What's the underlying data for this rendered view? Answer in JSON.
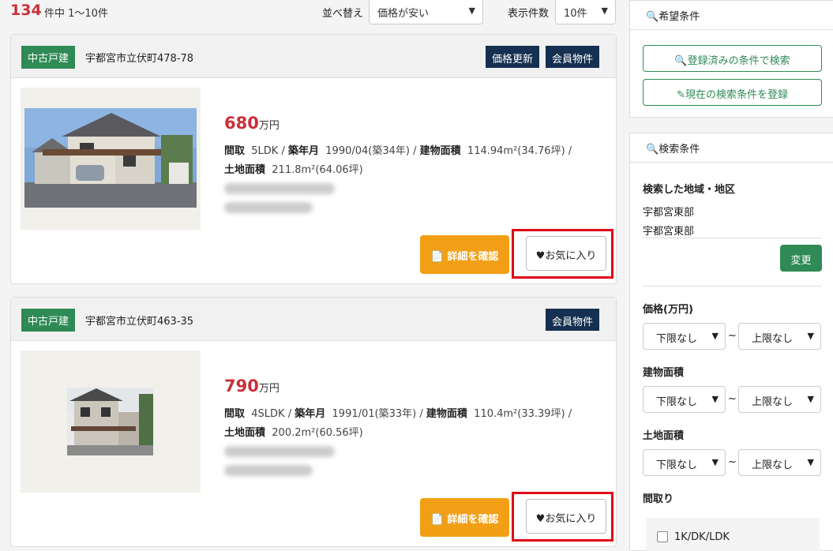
{
  "results": {
    "total": "134",
    "range_text": "件中 1〜10件",
    "sort_label": "並べ替え",
    "sort_value": "価格が安い",
    "count_label": "表示件数",
    "count_value": "10件"
  },
  "listings": [
    {
      "type": "中古戸建",
      "address": "宇都宮市立伏町478-78",
      "tags": [
        "価格更新",
        "会員物件"
      ],
      "price": "680",
      "price_unit": "万円",
      "layout_label": "間取",
      "layout": "5LDK",
      "built_label": "築年月",
      "built": "1990/04(築34年)",
      "building_area_label": "建物面積",
      "building_area": "114.94m²(34.76坪)",
      "land_area_label": "土地面積",
      "land_area": "211.8m²(64.06坪)",
      "detail_label": "詳細を確認",
      "favorite_label": "お気に入り"
    },
    {
      "type": "中古戸建",
      "address": "宇都宮市立伏町463-35",
      "tags": [
        "会員物件"
      ],
      "price": "790",
      "price_unit": "万円",
      "layout_label": "間取",
      "layout": "4SLDK",
      "built_label": "築年月",
      "built": "1991/01(築33年)",
      "building_area_label": "建物面積",
      "building_area": "110.4m²(33.39坪)",
      "land_area_label": "土地面積",
      "land_area": "200.2m²(60.56坪)",
      "detail_label": "詳細を確認",
      "favorite_label": "お気に入り"
    }
  ],
  "sidebar": {
    "wish_title": "希望条件",
    "search_saved_label": "登録済みの条件で検索",
    "save_current_label": "現在の検索条件を登録",
    "search_title": "検索条件",
    "region_label": "検索した地域・地区",
    "regions": [
      "宇都宮東部",
      "宇都宮東部"
    ],
    "change_label": "変更",
    "price_label": "価格(万円)",
    "building_area_label": "建物面積",
    "land_area_label": "土地面積",
    "layout_label": "間取り",
    "min_placeholder": "下限なし",
    "max_placeholder": "上限なし",
    "tilde": "~",
    "layout_option": "1K/DK/LDK"
  },
  "colors": {
    "price_red": "#c9303a",
    "badge_green": "#2f8a55",
    "tag_navy": "#153050",
    "detail_orange": "#f29f16",
    "highlight_red": "#e0001a"
  }
}
